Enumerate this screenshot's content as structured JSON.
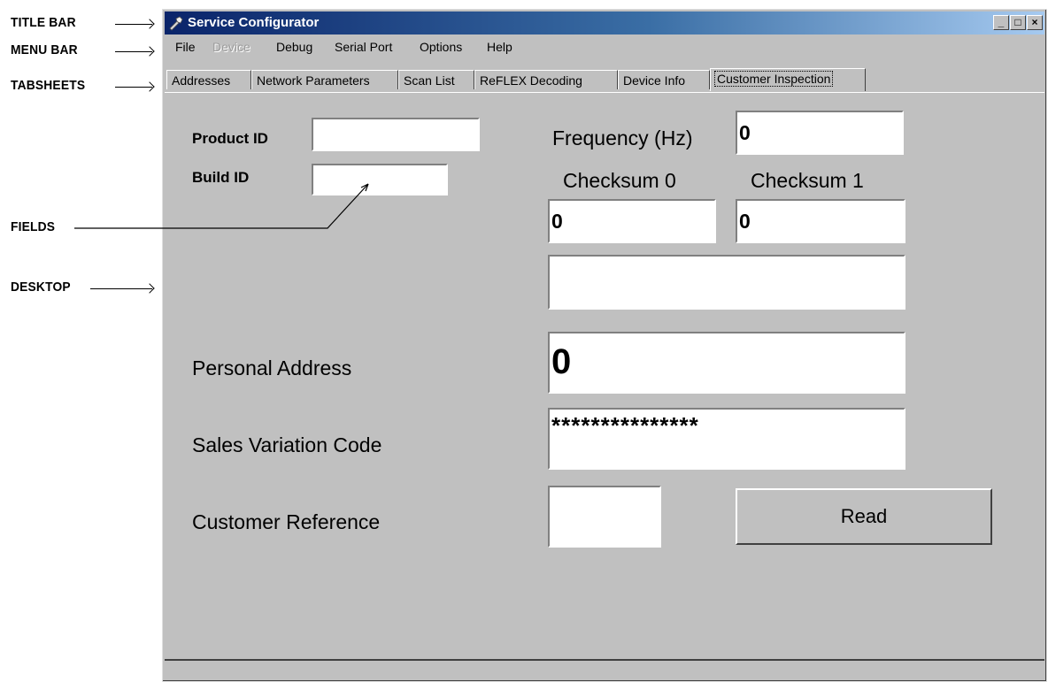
{
  "annotations": {
    "title_bar": "TITLE BAR",
    "menu_bar": "MENU BAR",
    "tabsheets": "TABSHEETS",
    "fields": "FIELDS",
    "desktop": "DESKTOP"
  },
  "window": {
    "title": "Service Configurator",
    "controls": {
      "minimize": "_",
      "maximize": "□",
      "close": "×"
    }
  },
  "menu": [
    "File",
    "Device",
    "Debug",
    "Serial Port",
    "Options",
    "Help"
  ],
  "tabs": [
    "Addresses",
    "Network Parameters",
    "Scan List",
    "ReFLEX Decoding",
    "Device Info",
    "Customer Inspection"
  ],
  "form": {
    "product_id_label": "Product ID",
    "product_id_value": "",
    "build_id_label": "Build ID",
    "build_id_value": "",
    "frequency_label": "Frequency (Hz)",
    "frequency_value": "0",
    "checksum0_label": "Checksum 0",
    "checksum0_value": "0",
    "checksum1_label": "Checksum 1",
    "checksum1_value": "0",
    "blank_value": "",
    "personal_address_label": "Personal Address",
    "personal_address_value": "0",
    "sales_variation_label": "Sales Variation Code",
    "sales_variation_value": "***************",
    "customer_reference_label": "Customer Reference",
    "customer_reference_value": "",
    "read_button": "Read"
  }
}
